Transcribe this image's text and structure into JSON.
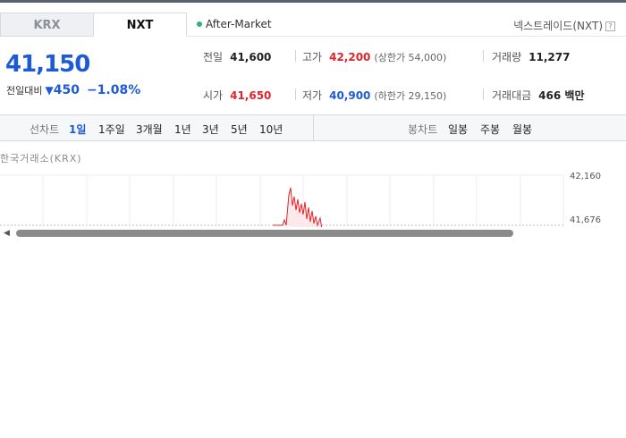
{
  "tabs": [
    {
      "label": "KRX",
      "active": false
    },
    {
      "label": "NXT",
      "active": true
    }
  ],
  "market_status": "After-Market",
  "nxt_link": "넥스트레이드(NXT)",
  "help_icon": "?",
  "price": {
    "current": "41,150",
    "change_label": "전일대비",
    "change_arrow": "▼",
    "change_value": "450",
    "change_pct": "−1.08%"
  },
  "stats": {
    "prev_close": {
      "label": "전일",
      "value": "41,600"
    },
    "high": {
      "label": "고가",
      "value": "42,200",
      "sub": "(상한가 54,000)"
    },
    "volume": {
      "label": "거래량",
      "value": "11,277"
    },
    "open": {
      "label": "시가",
      "value": "41,650"
    },
    "low": {
      "label": "저가",
      "value": "40,900",
      "sub": "(하한가 29,150)"
    },
    "turnover": {
      "label": "거래대금",
      "value": "466 백만"
    }
  },
  "line_chart_label": "선차트",
  "line_periods": [
    "1일",
    "1주일",
    "3개월",
    "1년",
    "3년",
    "5년",
    "10년"
  ],
  "active_period": "1일",
  "candle_chart_label": "봉차트",
  "candle_periods": [
    "일봉",
    "주봉",
    "월봉"
  ],
  "chart": {
    "title": "한국거래소(KRX)",
    "y_labels": [
      "42,160",
      "41,676"
    ],
    "line_color": "#e0242c",
    "grid_color": "#eeeeee"
  }
}
